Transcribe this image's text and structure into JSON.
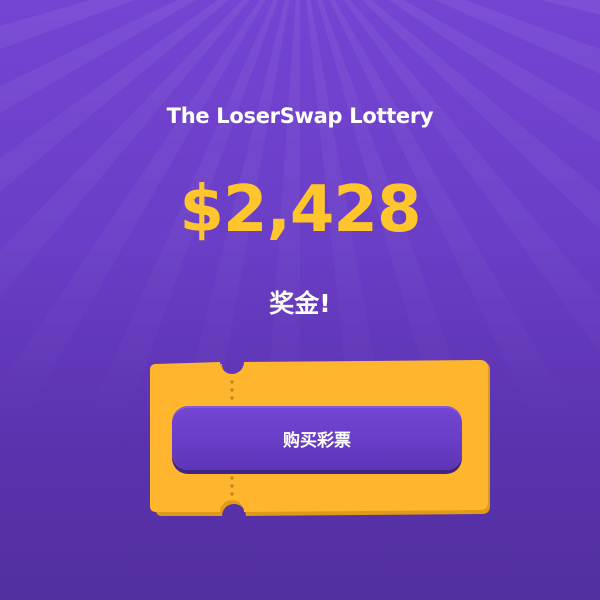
{
  "lottery": {
    "title": "The LoserSwap Lottery",
    "prize_amount": "$2,428",
    "prize_label": "奖金!",
    "buy_button_label": "购买彩票"
  },
  "colors": {
    "background_top": "#7444d3",
    "background_bottom": "#52309f",
    "prize_yellow": "#ffc52c",
    "ticket_orange": "#ffb62e",
    "button_purple": "#6a3ec8"
  }
}
